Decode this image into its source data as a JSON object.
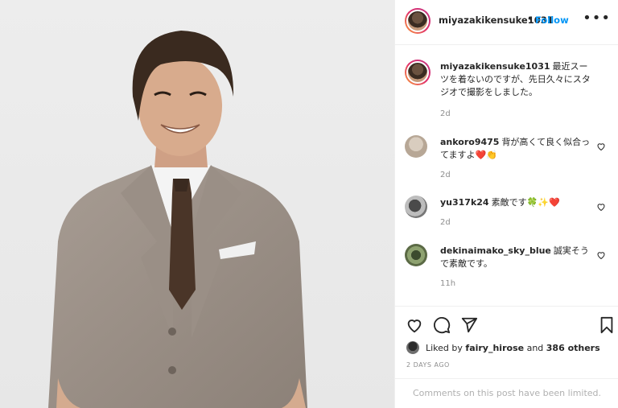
{
  "post": {
    "author": "miyazakikensuke1031",
    "follow_label": "Follow",
    "separator": "•",
    "more_label": "•••",
    "caption": "最近スーツを着ないのですが、先日久々にスタジオで撮影をしました。",
    "caption_time": "2d"
  },
  "comments": [
    {
      "user": "ankoro9475",
      "text": "背が高くて良く似合ってますよ❤️👏",
      "time": "2d"
    },
    {
      "user": "yu317k24",
      "text": "素敵です🍀✨❤️",
      "time": "2d"
    },
    {
      "user": "dekinaimako_sky_blue",
      "text": "誠実そうで素敵です。",
      "time": "11h"
    }
  ],
  "footer": {
    "liked_by_prefix": "Liked by",
    "liked_by_user": "fairy_hirose",
    "and_label": "and",
    "others_label": "386 others",
    "posted_ago": "2 DAYS AGO",
    "comments_limited": "Comments on this post have been limited."
  },
  "colors": {
    "link": "#0095f6",
    "muted": "#8e8e8e",
    "text": "#262626"
  },
  "icons": [
    "heart-icon",
    "comment-icon",
    "share-icon",
    "bookmark-icon",
    "more-icon"
  ]
}
